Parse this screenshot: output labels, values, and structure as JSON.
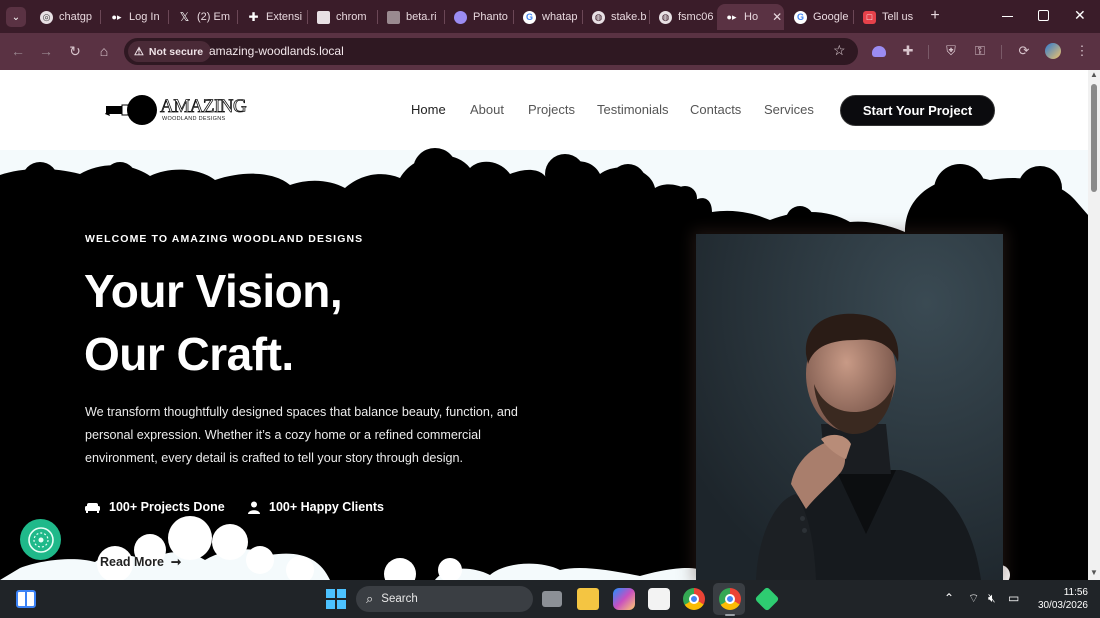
{
  "browser": {
    "tabs": [
      {
        "label": "chatgp",
        "icon": "chatgpt-icon"
      },
      {
        "label": "Log In",
        "icon": "login-icon"
      },
      {
        "label": "(2) Em",
        "icon": "x-icon"
      },
      {
        "label": "Extensi",
        "icon": "extensions-icon"
      },
      {
        "label": "chrom",
        "icon": "chrome-page-icon"
      },
      {
        "label": "beta.ri",
        "icon": "site-icon"
      },
      {
        "label": "Phanto",
        "icon": "phantom-icon"
      },
      {
        "label": "whatap",
        "icon": "google-icon"
      },
      {
        "label": "stake.b",
        "icon": "globe-icon"
      },
      {
        "label": "fsmc06",
        "icon": "globe-icon"
      },
      {
        "label": "Ho",
        "icon": "home-icon",
        "active": true
      },
      {
        "label": "Google",
        "icon": "google-icon"
      },
      {
        "label": "Tell us",
        "icon": "form-icon"
      }
    ],
    "security_label": "Not secure",
    "url": "amazing-woodlands.local"
  },
  "site": {
    "logo_text": "AMAZING",
    "logo_subtext": "WOODLAND DESIGNS",
    "nav": [
      "Home",
      "About",
      "Projects",
      "Testimonials",
      "Contacts",
      "Services"
    ],
    "cta_label": "Start Your Project",
    "eyebrow": "WELCOME TO AMAZING WOODLAND DESIGNS",
    "headline_line1": "Your Vision,",
    "headline_line2": "Our Craft.",
    "description": "We transform thoughtfully designed spaces that balance beauty, function, and personal expression. Whether it’s a cozy home or a refined commercial environment, every detail is crafted to tell your story through design.",
    "stats": [
      {
        "icon": "couch-icon",
        "label": "100+ Projects Done"
      },
      {
        "icon": "user-icon",
        "label": "100+ Happy Clients"
      }
    ],
    "read_more": "Read More"
  },
  "taskbar": {
    "search_placeholder": "Search",
    "time": "11:56",
    "date": "30/03/2026"
  }
}
